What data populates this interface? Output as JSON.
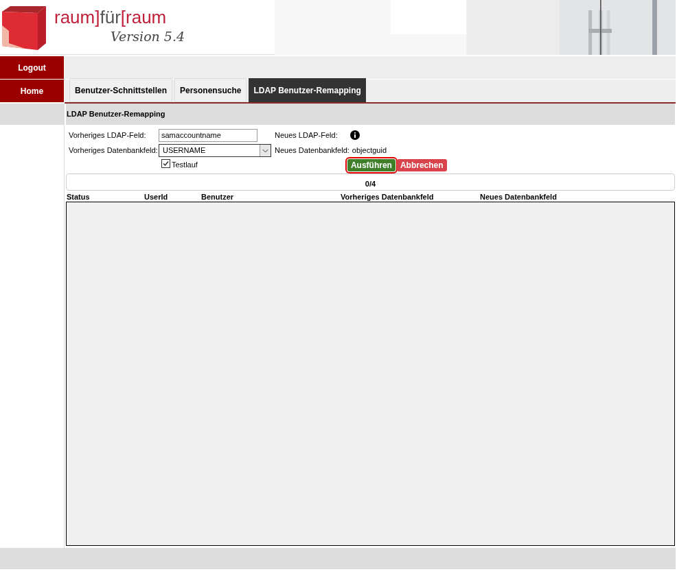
{
  "logo": {
    "parts": [
      {
        "text": "raum]",
        "color": "#c0203a"
      },
      {
        "text": "für",
        "color": "#555555"
      },
      {
        "text": "[raum",
        "color": "#c0203a"
      }
    ],
    "version": "Version 5.4"
  },
  "sidebar": {
    "items": [
      "Logout",
      "Home"
    ]
  },
  "tabs": [
    {
      "label": "Benutzer-Schnittstellen",
      "selected": false
    },
    {
      "label": "Personensuche",
      "selected": false
    },
    {
      "label": "LDAP Benutzer-Remapping",
      "selected": true
    }
  ],
  "section_title": "LDAP Benutzer-Remapping",
  "form": {
    "old_ldap_label": "Vorheriges LDAP-Feld:",
    "old_ldap_value": "samaccountname",
    "new_ldap_label": "Neues LDAP-Feld:",
    "old_db_label": "Vorheriges Datenbankfeld:",
    "old_db_value": "USERNAME",
    "new_db_label": "Neues Datenbankfeld:",
    "new_db_value": "objectguid",
    "testrun": {
      "label": "Testlauf",
      "checked": true
    }
  },
  "buttons": [
    {
      "label": "Ausführen",
      "kind": "run",
      "highlighted": true
    },
    {
      "label": "Abbrechen",
      "kind": "cancel",
      "highlighted": false
    }
  ],
  "progress": {
    "text": "0/4"
  },
  "table": {
    "columns": [
      "Status",
      "UserId",
      "Benutzer",
      "Vorheriges Datenbankfeld",
      "Neues Datenbankfeld"
    ]
  }
}
